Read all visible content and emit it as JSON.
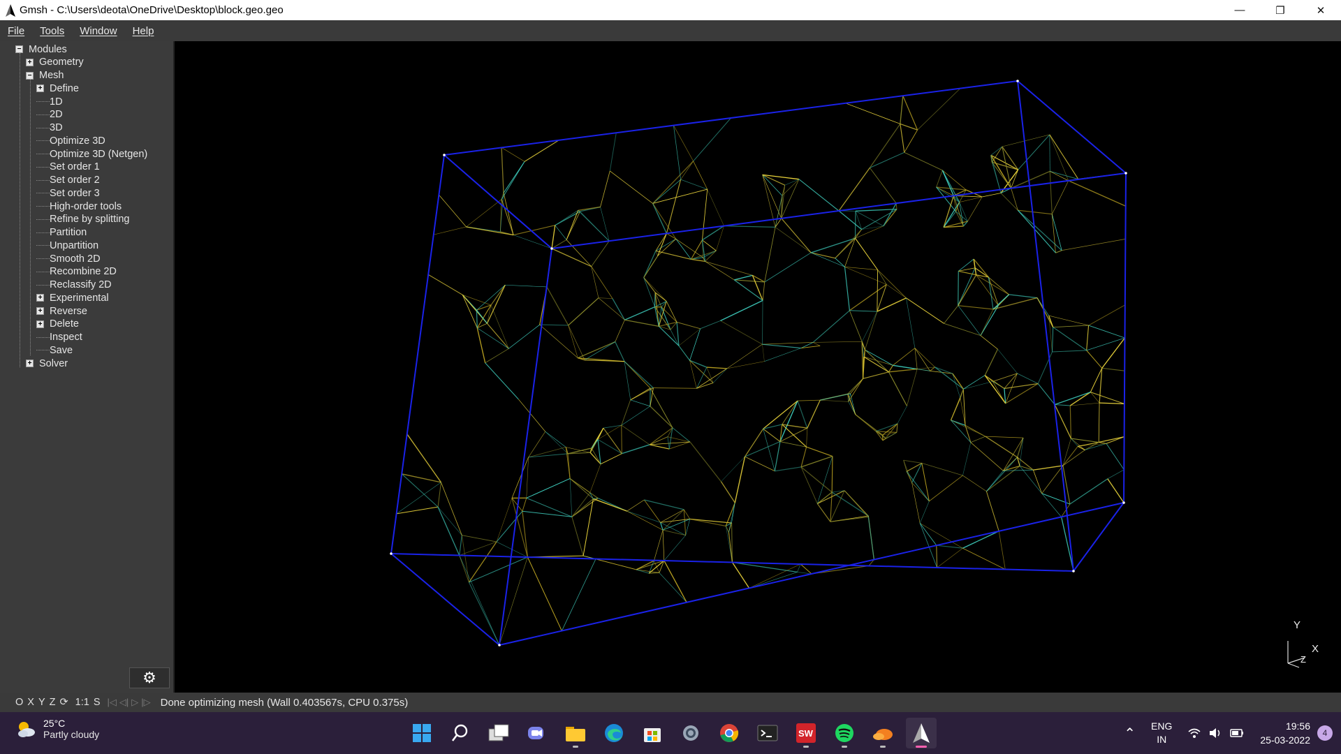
{
  "window": {
    "title": "Gmsh - C:\\Users\\deota\\OneDrive\\Desktop\\block.geo.geo",
    "minimize": "—",
    "restore": "❐",
    "close": "✕"
  },
  "menubar": [
    "File",
    "Tools",
    "Window",
    "Help"
  ],
  "tree": [
    {
      "label": "Modules",
      "toggle": "−"
    },
    {
      "label": "Geometry",
      "toggle": "+"
    },
    {
      "label": "Mesh",
      "toggle": "−"
    },
    {
      "label": "Define",
      "toggle": "+"
    },
    {
      "label": "1D",
      "toggle": ""
    },
    {
      "label": "2D",
      "toggle": ""
    },
    {
      "label": "3D",
      "toggle": ""
    },
    {
      "label": "Optimize 3D",
      "toggle": ""
    },
    {
      "label": "Optimize 3D (Netgen)",
      "toggle": ""
    },
    {
      "label": "Set order 1",
      "toggle": ""
    },
    {
      "label": "Set order 2",
      "toggle": ""
    },
    {
      "label": "Set order 3",
      "toggle": ""
    },
    {
      "label": "High-order tools",
      "toggle": ""
    },
    {
      "label": "Refine by splitting",
      "toggle": ""
    },
    {
      "label": "Partition",
      "toggle": ""
    },
    {
      "label": "Unpartition",
      "toggle": ""
    },
    {
      "label": "Smooth 2D",
      "toggle": ""
    },
    {
      "label": "Recombine 2D",
      "toggle": ""
    },
    {
      "label": "Reclassify 2D",
      "toggle": ""
    },
    {
      "label": "Experimental",
      "toggle": "+"
    },
    {
      "label": "Reverse",
      "toggle": "+"
    },
    {
      "label": "Delete",
      "toggle": "+"
    },
    {
      "label": "Inspect",
      "toggle": ""
    },
    {
      "label": "Save",
      "toggle": ""
    },
    {
      "label": "Solver",
      "toggle": "+"
    }
  ],
  "statusbar": {
    "view_buttons": [
      "O",
      "X",
      "Y",
      "Z",
      "⟳",
      "1:1",
      "S"
    ],
    "anim_buttons": [
      "|◁",
      "◁|",
      "▷",
      "|▷"
    ],
    "message": "Done optimizing mesh (Wall 0.403567s, CPU 0.375s)"
  },
  "axes": {
    "y": "Y",
    "x": "X",
    "z": "Z"
  },
  "taskbar": {
    "weather_temp": "25°C",
    "weather_desc": "Partly cloudy",
    "apps": [
      "start",
      "search",
      "task-view",
      "teams-chat",
      "file-explorer",
      "edge",
      "store",
      "settings",
      "chrome",
      "terminal",
      "solidworks",
      "spotify",
      "cloud-app",
      "gmsh"
    ],
    "lang_line1": "ENG",
    "lang_line2": "IN",
    "time": "19:56",
    "date": "25-03-2022",
    "notifications": "4"
  },
  "colors": {
    "mesh_yellow": "#e8d23a",
    "mesh_cyan": "#3fd0c0",
    "mesh_olive": "#8a8a2a",
    "box_blue": "#1a22e8",
    "panel": "#3b3b3b",
    "taskbar": "#2b1f3a"
  }
}
